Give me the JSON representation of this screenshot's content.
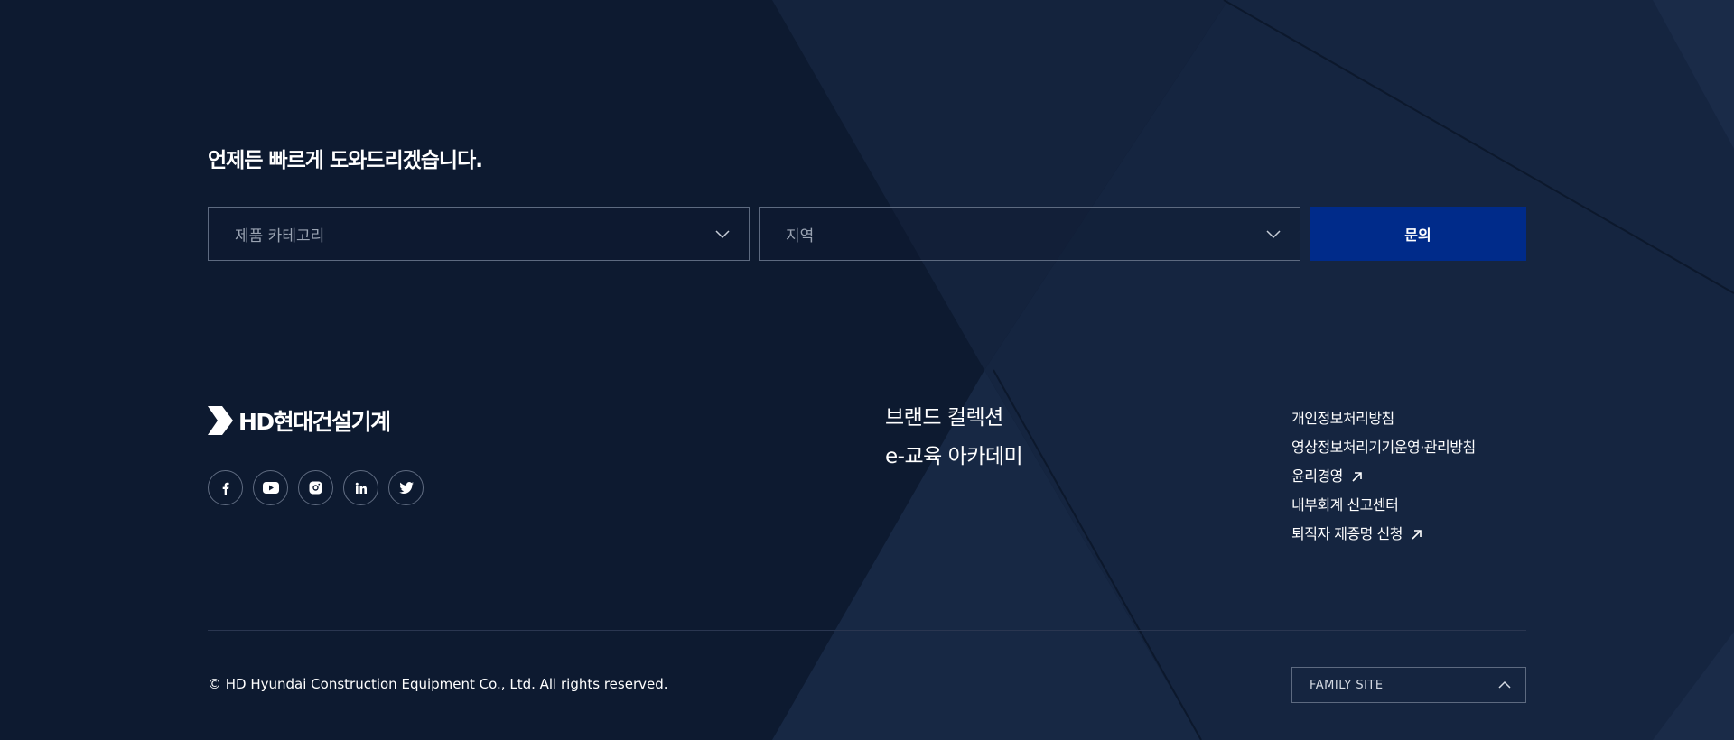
{
  "inquiry": {
    "title": "언제든 빠르게 도와드리겠습니다.",
    "category_placeholder": "제품 카테고리",
    "region_placeholder": "지역",
    "submit_label": "문의"
  },
  "brand": {
    "logo_text": "HD현대건설기계"
  },
  "social": [
    {
      "name": "facebook-icon"
    },
    {
      "name": "youtube-icon"
    },
    {
      "name": "instagram-icon"
    },
    {
      "name": "linkedin-icon"
    },
    {
      "name": "twitter-icon"
    }
  ],
  "mid_links": [
    {
      "label": "브랜드 컬렉션"
    },
    {
      "label": "e-교육 아카데미"
    }
  ],
  "policy_links": [
    {
      "label": "개인정보처리방침",
      "external": false
    },
    {
      "label": "영상정보처리기기운영·관리방침",
      "external": false
    },
    {
      "label": "윤리경영",
      "external": true
    },
    {
      "label": "내부회계 신고센터",
      "external": false
    },
    {
      "label": "퇴직자 제증명 신청",
      "external": true
    }
  ],
  "footer": {
    "copyright": "© HD Hyundai Construction Equipment Co., Ltd. All rights reserved.",
    "family_site_label": "FAMILY SITE"
  },
  "colors": {
    "background": "#0d1a30",
    "accent_button": "#002b8a",
    "border": "#5d6a80"
  }
}
